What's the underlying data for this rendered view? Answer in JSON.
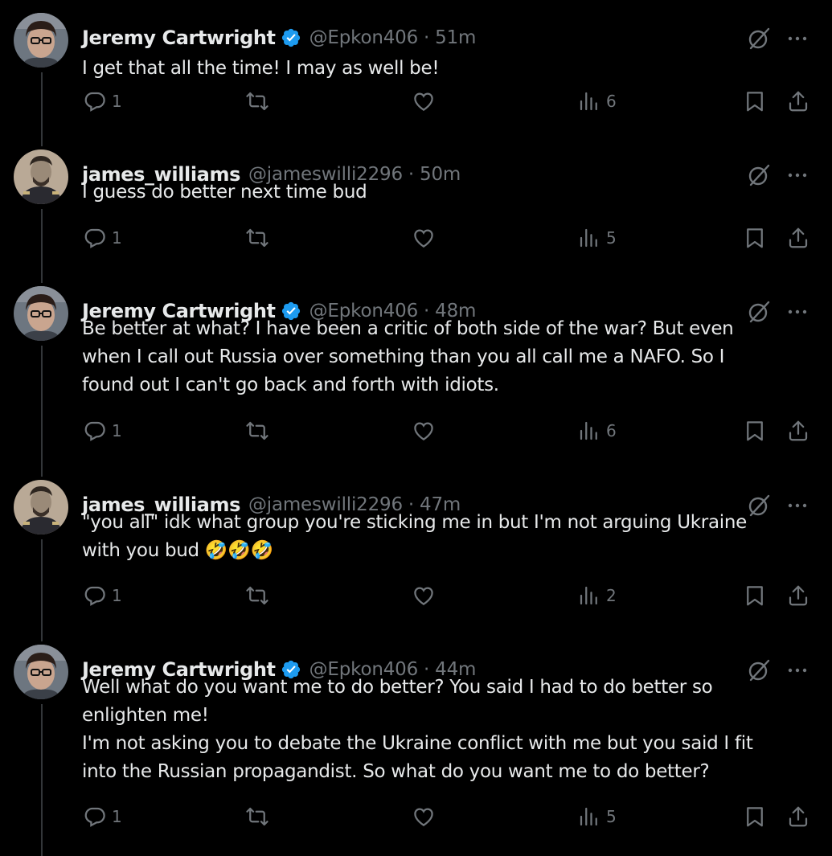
{
  "colors": {
    "background": "#000000",
    "text": "#e7e9ea",
    "secondary": "#71767b",
    "verified": "#1d9bf0",
    "thread_line": "#333639"
  },
  "tweets": [
    {
      "name": "Jeremy Cartwright",
      "verified": true,
      "handle": "@Epkon406",
      "sep": "·",
      "time": "51m",
      "lines": [
        "I get that all the time! I may as well be!"
      ],
      "replies": "1",
      "views": "6",
      "avatar": "jeremy-avatar"
    },
    {
      "name": "james_williams",
      "verified": false,
      "handle": "@jameswilli2296",
      "sep": "·",
      "time": "50m",
      "lines": [
        "I guess do better next time bud"
      ],
      "replies": "1",
      "views": "5",
      "avatar": "james-avatar"
    },
    {
      "name": "Jeremy Cartwright",
      "verified": true,
      "handle": "@Epkon406",
      "sep": "·",
      "time": "48m",
      "lines": [
        "Be better at what? I have been a critic of both side of the war? But even",
        "when I call out Russia over something than you all call me a NAFO. So I",
        "found out I can't go back and forth with idiots."
      ],
      "replies": "1",
      "views": "6",
      "avatar": "jeremy-avatar"
    },
    {
      "name": "james_williams",
      "verified": false,
      "handle": "@jameswilli2296",
      "sep": "·",
      "time": "47m",
      "lines": [
        "\"you all\" idk what group you're sticking me in but I'm not arguing Ukraine",
        "with you bud 🤣🤣🤣"
      ],
      "replies": "1",
      "views": "2",
      "avatar": "james-avatar"
    },
    {
      "name": "Jeremy Cartwright",
      "verified": true,
      "handle": "@Epkon406",
      "sep": "·",
      "time": "44m",
      "lines": [
        "Well what do you want me to do better? You said I had to do better so",
        "enlighten me!",
        "I'm not asking you to debate the Ukraine conflict with me but you said I fit",
        "into the Russian propagandist. So what do you want me to do better?"
      ],
      "replies": "1",
      "views": "5",
      "avatar": "jeremy-avatar"
    }
  ]
}
